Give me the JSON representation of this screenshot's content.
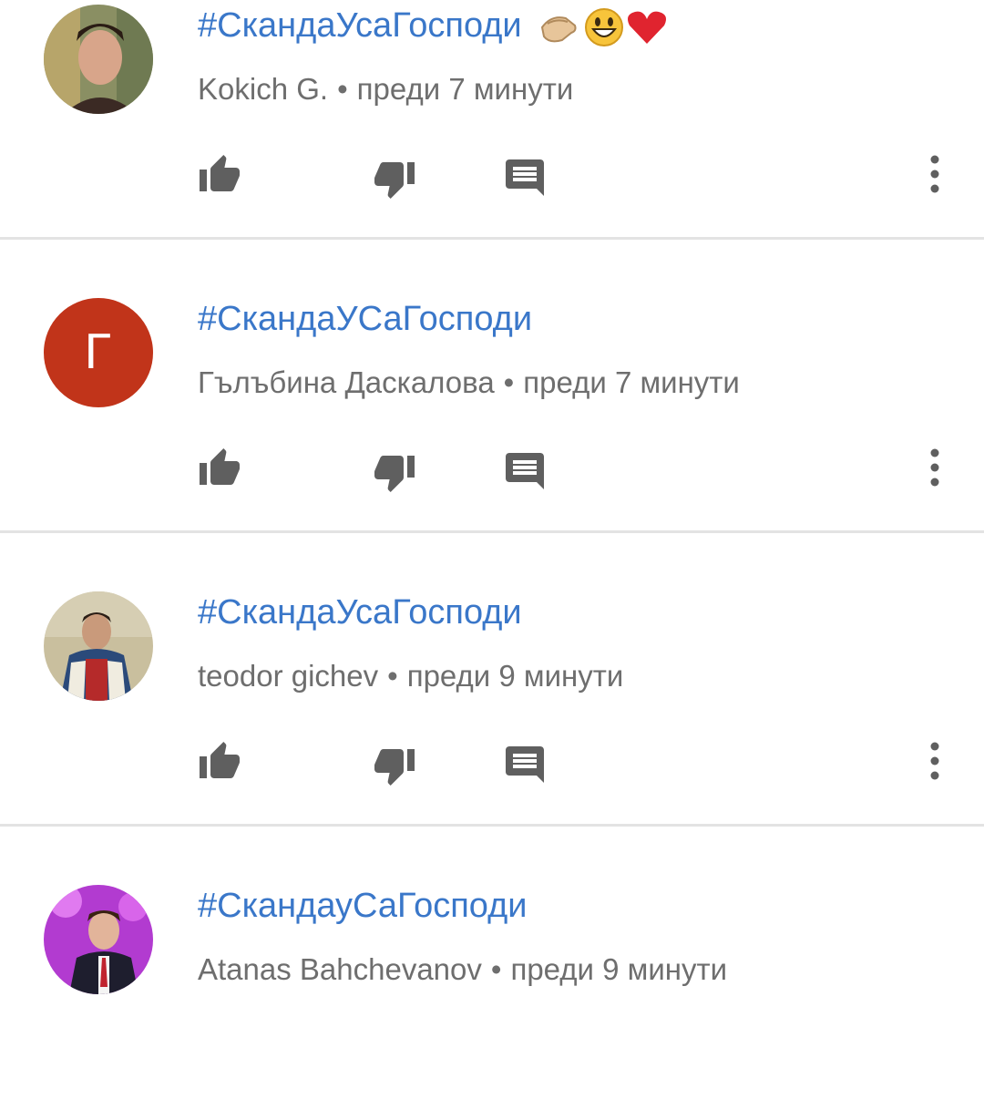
{
  "colors": {
    "link": "#3a77c9",
    "meta": "#6e6e6e",
    "icon": "#5f5f5f",
    "divider": "#e3e3e3",
    "letter_avatar_bg": "#c1341a"
  },
  "actions": {
    "like_icon": "thumb-up-icon",
    "dislike_icon": "thumb-down-icon",
    "reply_icon": "comment-icon",
    "more_icon": "more-vertical-icon"
  },
  "comments": [
    {
      "text": "#СкандаУсаГосподи",
      "emojis": [
        "clapping-hands-icon",
        "grinning-face-icon",
        "red-heart-icon"
      ],
      "author": "Kokich G.",
      "separator": "•",
      "time": "преди 7 минути",
      "avatar": "photo"
    },
    {
      "text": "#СкандаУСаГосподи",
      "author": "Гълъбина Даскалова",
      "separator": "•",
      "time": "преди 7 минути",
      "avatar_letter": "Г"
    },
    {
      "text": "#СкандаУсаГосподи",
      "author": "teodor gichev",
      "separator": "•",
      "time": "преди 9 минути",
      "avatar": "photo"
    },
    {
      "text": "#СкандауСаГосподи",
      "author": "Atanas Bahchevanov",
      "separator": "•",
      "time": "преди 9 минути",
      "avatar": "photo"
    }
  ]
}
